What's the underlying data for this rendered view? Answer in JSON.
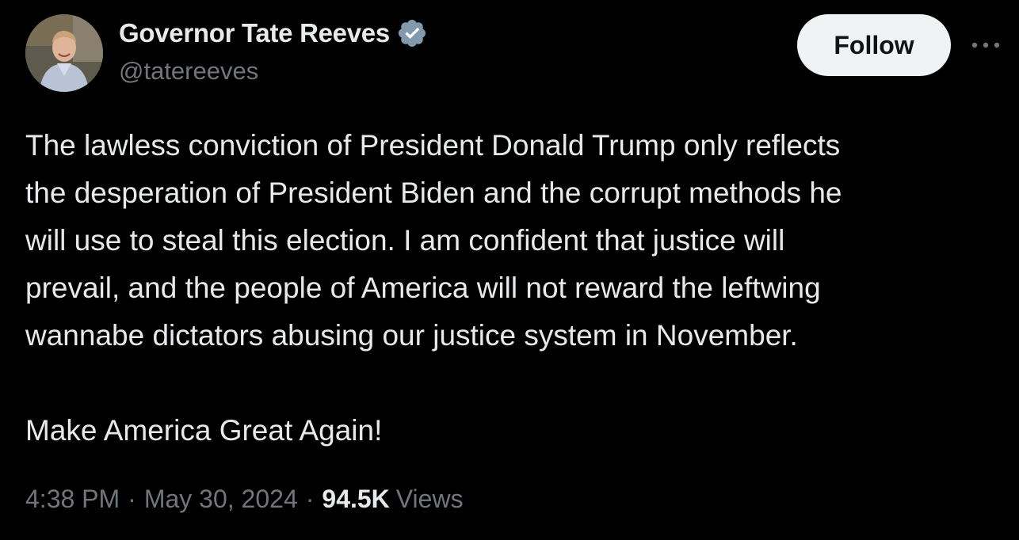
{
  "author": {
    "display_name": "Governor Tate Reeves",
    "handle": "@tatereeves",
    "verified": true,
    "verified_color": "#829aab"
  },
  "actions": {
    "follow_label": "Follow",
    "more_icon": "more-horizontal-icon"
  },
  "tweet": {
    "lines": [
      "The lawless conviction of President Donald Trump only reflects",
      "the desperation of President Biden and the corrupt methods he",
      "will use to steal this election. I am confident that justice will",
      "prevail, and the people of America will not reward the leftwing",
      "wannabe dictators abusing our justice system in November.",
      "Make America Great Again!"
    ]
  },
  "meta": {
    "time": "4:38 PM",
    "date": "May 30, 2024",
    "separator": "·",
    "views_count": "94.5K",
    "views_label": "Views"
  },
  "colors": {
    "background": "#000000",
    "text": "#e7e9ea",
    "secondary": "#71767b",
    "follow_bg": "#eff3f4",
    "follow_text": "#0f1419"
  }
}
